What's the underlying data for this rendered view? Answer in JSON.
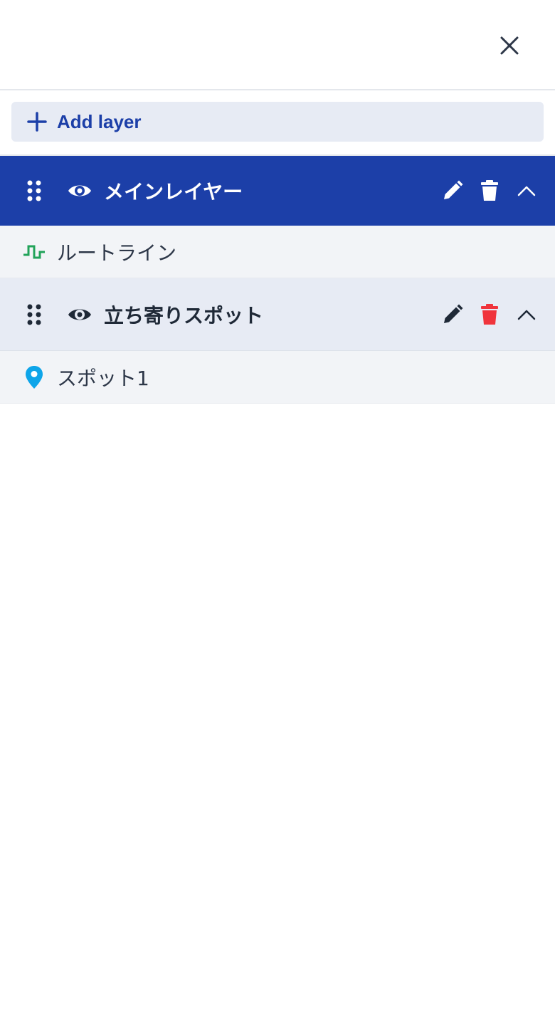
{
  "panel": {
    "close_icon": "close-icon",
    "add_layer_label": "Add layer",
    "add_icon": "plus-icon"
  },
  "colors": {
    "accent": "#1c3fa8",
    "accent_light": "#e7ebf4",
    "route_green": "#22a35a",
    "pin_blue": "#0ea5e9",
    "danger_red": "#f0343c",
    "text_dark": "#1f2937"
  },
  "layers": [
    {
      "title": "メインレイヤー",
      "selected": true,
      "expanded": true,
      "items": [
        {
          "label": "ルートライン",
          "icon": "route-line-icon"
        }
      ]
    },
    {
      "title": "立ち寄りスポット",
      "selected": false,
      "expanded": true,
      "items": [
        {
          "label": "スポット1",
          "icon": "map-pin-icon"
        }
      ]
    }
  ]
}
